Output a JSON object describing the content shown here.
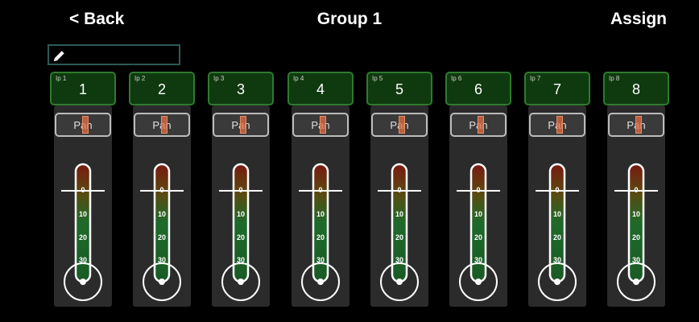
{
  "header": {
    "back_label": "< Back",
    "title": "Group 1",
    "assign_label": "Assign"
  },
  "name_field": {
    "value": "",
    "icon": "pencil-icon"
  },
  "colors": {
    "channel_fill": "#0f3a0f",
    "channel_border": "#2f7a2f",
    "strip_bg": "#2b2b2b",
    "pan_indicator": "#e88a60",
    "meter_top": "#7a1a10",
    "meter_bottom": "#1e6a2a"
  },
  "scale_labels": [
    "0",
    "10",
    "20",
    "30"
  ],
  "channels": [
    {
      "label": "Ip 1",
      "number": "1",
      "pan_label": "Pan"
    },
    {
      "label": "Ip 2",
      "number": "2",
      "pan_label": "Pan"
    },
    {
      "label": "Ip 3",
      "number": "3",
      "pan_label": "Pan"
    },
    {
      "label": "Ip 4",
      "number": "4",
      "pan_label": "Pan"
    },
    {
      "label": "Ip 5",
      "number": "5",
      "pan_label": "Pan"
    },
    {
      "label": "Ip 6",
      "number": "6",
      "pan_label": "Pan"
    },
    {
      "label": "Ip 7",
      "number": "7",
      "pan_label": "Pan"
    },
    {
      "label": "Ip 8",
      "number": "8",
      "pan_label": "Pan"
    }
  ]
}
